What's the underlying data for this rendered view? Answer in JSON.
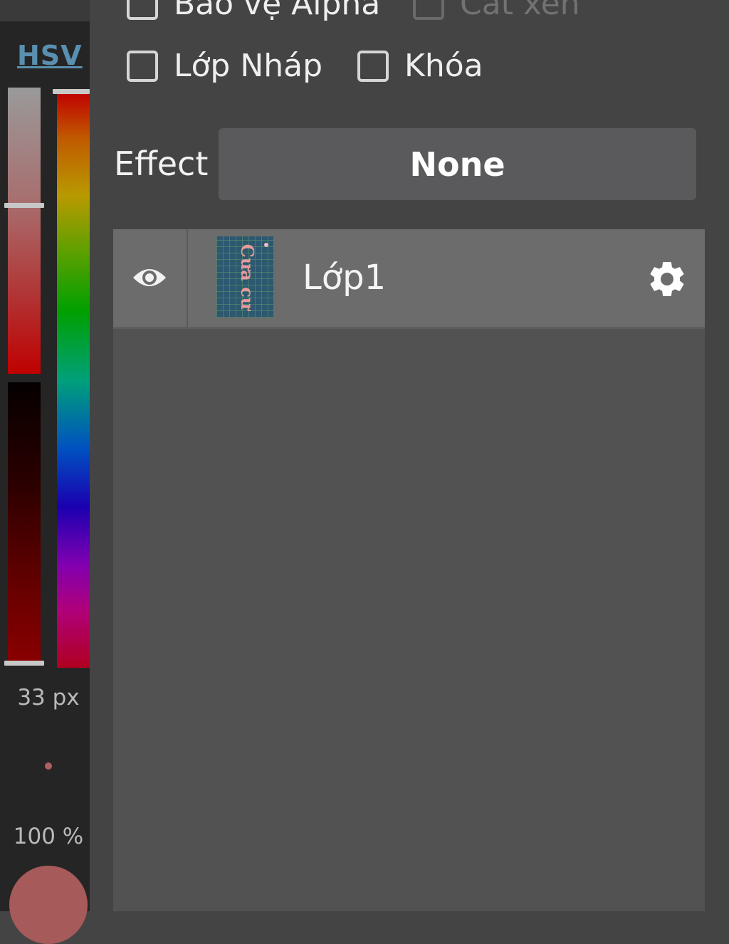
{
  "color_panel": {
    "mode_tab": "HSV",
    "brush_size": "33 px",
    "opacity": "100 %",
    "colors": {
      "current_color": "#a65a5a",
      "mode_tab_color": "#5a8fb0"
    }
  },
  "layer_options": {
    "checkboxes": [
      {
        "label": "Bảo vệ Alpha",
        "checked": false,
        "enabled": true
      },
      {
        "label": "Cắt xén",
        "checked": false,
        "enabled": false
      },
      {
        "label": "Lớp Nháp",
        "checked": false,
        "enabled": true
      },
      {
        "label": "Khóa",
        "checked": false,
        "enabled": true
      }
    ],
    "effect_label": "Effect",
    "effect_value": "None"
  },
  "layers": [
    {
      "name": "Lớp1",
      "visible": true,
      "thumbnail_text": "Cưa cư",
      "icons": [
        "eye-icon",
        "gear-icon"
      ]
    }
  ]
}
